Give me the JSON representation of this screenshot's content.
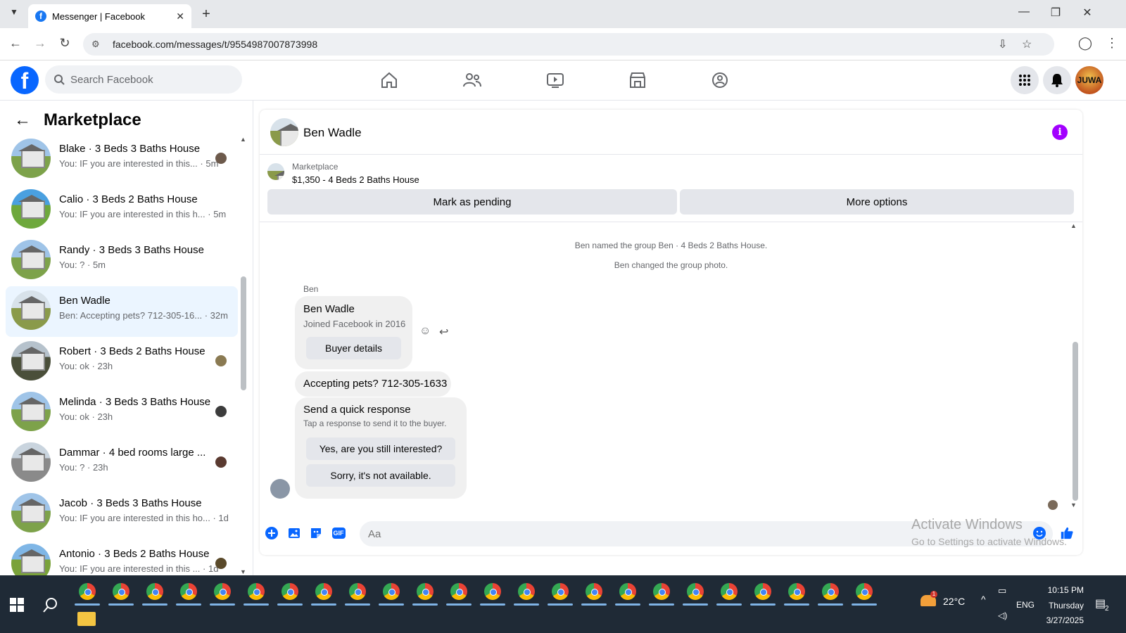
{
  "browser": {
    "tab_title": "Messenger | Facebook",
    "url": "facebook.com/messages/t/9554987007873998"
  },
  "fb": {
    "search_placeholder": "Search Facebook",
    "avatar_text": "JUWA"
  },
  "sidebar": {
    "title": "Marketplace",
    "conversations": [
      {
        "name": "Blake · 3 Beds 3 Baths House",
        "preview": "You: IF you are interested in this... · 5m"
      },
      {
        "name": "Calio · 3 Beds 2 Baths House",
        "preview": "You: IF you are interested in this h... · 5m"
      },
      {
        "name": "Randy · 3 Beds 3 Baths House",
        "preview": "You: ? · 5m"
      },
      {
        "name": "Ben Wadle",
        "preview": "Ben: Accepting pets? 712-305-16... · 32m"
      },
      {
        "name": "Robert · 3 Beds 2 Baths House",
        "preview": "You: ok · 23h"
      },
      {
        "name": "Melinda · 3 Beds 3 Baths House",
        "preview": "You: ok · 23h"
      },
      {
        "name": "Dammar · 4 bed rooms large ...",
        "preview": "You: ? · 23h"
      },
      {
        "name": "Jacob · 3 Beds 3 Baths House",
        "preview": "You: IF you are interested in this ho... · 1d"
      },
      {
        "name": "Antonio · 3 Beds 2 Baths House",
        "preview": "You: IF you are interested in this ... · 1d"
      }
    ]
  },
  "chat": {
    "contact_name": "Ben Wadle",
    "marketplace_label": "Marketplace",
    "listing": "$1,350 - 4 Beds 2 Baths House",
    "mark_pending": "Mark as pending",
    "more_options": "More options",
    "system_1": "Ben named the group Ben · 4 Beds 2 Baths House.",
    "system_2": "Ben changed the group photo.",
    "sender_label": "Ben",
    "card_name": "Ben Wadle",
    "card_sub": "Joined Facebook in 2016",
    "buyer_details": "Buyer details",
    "message": "Accepting pets? 712-305-1633",
    "quick_title": "Send a quick response",
    "quick_sub": "Tap a response to send it to the buyer.",
    "quick_1": "Yes, are you still interested?",
    "quick_2": "Sorry, it's not available.",
    "input_placeholder": "Aa",
    "gif_label": "GIF"
  },
  "watermark": {
    "line1": "Activate Windows",
    "line2": "Go to Settings to activate Windows."
  },
  "taskbar": {
    "weather": "22°C",
    "lang": "ENG",
    "time": "10:15 PM",
    "day": "Thursday",
    "date": "3/27/2025",
    "notif_count": "2",
    "weather_badge": "1"
  },
  "colors": {
    "fb_blue": "#0866ff",
    "info_purple": "#a200ff",
    "active_row": "#ebf5ff",
    "taskbar": "#1f2a36"
  }
}
